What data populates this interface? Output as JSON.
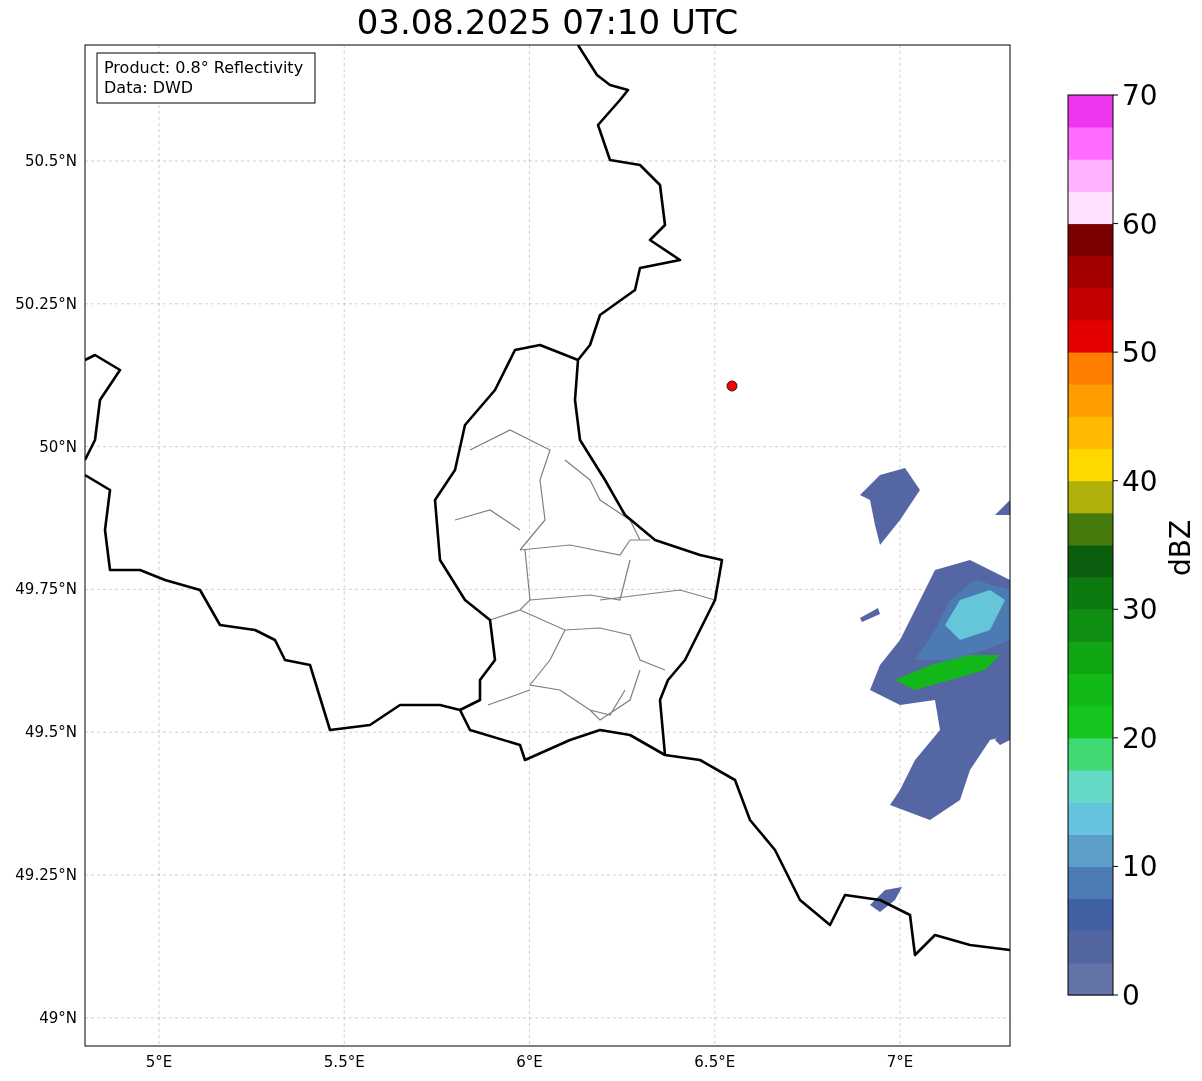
{
  "title": "03.08.2025 07:10 UTC",
  "info_box": {
    "lines": [
      "Product: 0.8° Reflectivity",
      "Data: DWD"
    ]
  },
  "lat_ticks": [
    "50.5°N",
    "50.25°N",
    "50°N",
    "49.75°N",
    "49.5°N",
    "49.25°N",
    "49°N"
  ],
  "lon_ticks": [
    "5°E",
    "5.5°E",
    "6°E",
    "6.5°E",
    "7°E"
  ],
  "colorbar": {
    "label": "dBZ",
    "ticks": [
      "70",
      "60",
      "50",
      "40",
      "30",
      "20",
      "10",
      "0"
    ],
    "bands": [
      {
        "color": "#6574a7"
      },
      {
        "color": "#5366a0"
      },
      {
        "color": "#4260a4"
      },
      {
        "color": "#4d7cb5"
      },
      {
        "color": "#5b9ec7"
      },
      {
        "color": "#65c3de"
      },
      {
        "color": "#63d9c6"
      },
      {
        "color": "#3fd871"
      },
      {
        "color": "#14c61e"
      },
      {
        "color": "#13ba17"
      },
      {
        "color": "#10a512"
      },
      {
        "color": "#0e8f12"
      },
      {
        "color": "#0d7a10"
      },
      {
        "color": "#0b5e0d"
      },
      {
        "color": "#477a0c"
      },
      {
        "color": "#afb10a"
      },
      {
        "color": "#ffd800"
      },
      {
        "color": "#ffb900"
      },
      {
        "color": "#ff9c00"
      },
      {
        "color": "#ff7e00"
      },
      {
        "color": "#e50000"
      },
      {
        "color": "#c40000"
      },
      {
        "color": "#a50000"
      },
      {
        "color": "#7d0000"
      },
      {
        "color": "#ffe0ff"
      },
      {
        "color": "#ffb3ff"
      },
      {
        "color": "#ff6aff"
      },
      {
        "color": "#ee36ee"
      }
    ]
  }
}
